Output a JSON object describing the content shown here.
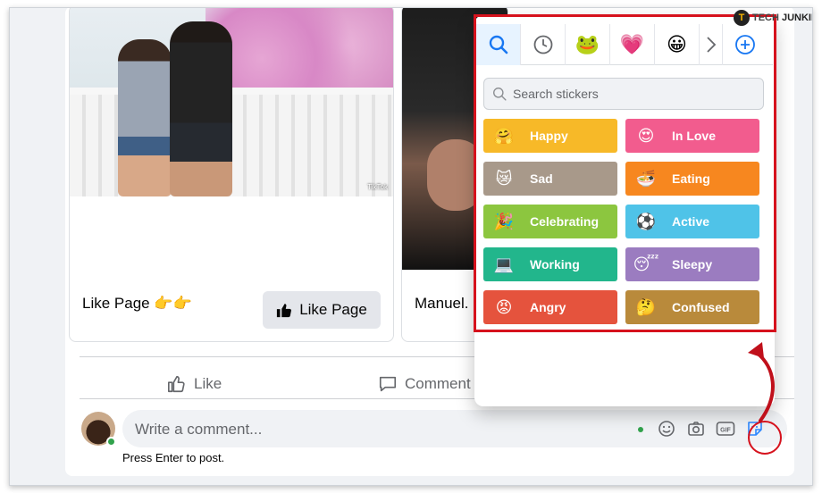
{
  "branding": {
    "logo_letter": "T",
    "tech": "TECH",
    "junkie": "JUNKIE"
  },
  "card1": {
    "title": "Like Page 👉👉",
    "tiktok_label": "TikTok",
    "like_button_label": "Like Page"
  },
  "card2": {
    "title": "Manuel."
  },
  "actions": {
    "like_label": "Like",
    "comment_label": "Comment"
  },
  "composer": {
    "placeholder": "Write a comment...",
    "hint": "Press Enter to post."
  },
  "sticker_picker": {
    "tabs": [
      {
        "name": "search-icon",
        "glyph": "🔍"
      },
      {
        "name": "recent-clock-icon",
        "glyph": "🕓"
      },
      {
        "name": "sticker-pack-icon",
        "glyph": "🐸"
      },
      {
        "name": "heart-pack-icon",
        "glyph": "💗"
      },
      {
        "name": "smiley-pack-icon",
        "glyph": "😀"
      },
      {
        "name": "chevron-right-icon",
        "glyph": "›"
      },
      {
        "name": "add-sticker-icon",
        "glyph": "⊕"
      }
    ],
    "search_placeholder": "Search stickers",
    "categories": [
      {
        "label": "Happy",
        "color": "#f7b928",
        "art": "🤗"
      },
      {
        "label": "In Love",
        "color": "#f25c8e",
        "art": "😍"
      },
      {
        "label": "Sad",
        "color": "#a8998a",
        "art": "😿"
      },
      {
        "label": "Eating",
        "color": "#f7871f",
        "art": "🍜"
      },
      {
        "label": "Celebrating",
        "color": "#8cc63f",
        "art": "🎉"
      },
      {
        "label": "Active",
        "color": "#4fc3e8",
        "art": "⚽"
      },
      {
        "label": "Working",
        "color": "#22b68c",
        "art": "💻"
      },
      {
        "label": "Sleepy",
        "color": "#9b7cc0",
        "art": "😴"
      },
      {
        "label": "Angry",
        "color": "#e5533d",
        "art": "😡"
      },
      {
        "label": "Confused",
        "color": "#b98a3b",
        "art": "🤔"
      }
    ]
  }
}
